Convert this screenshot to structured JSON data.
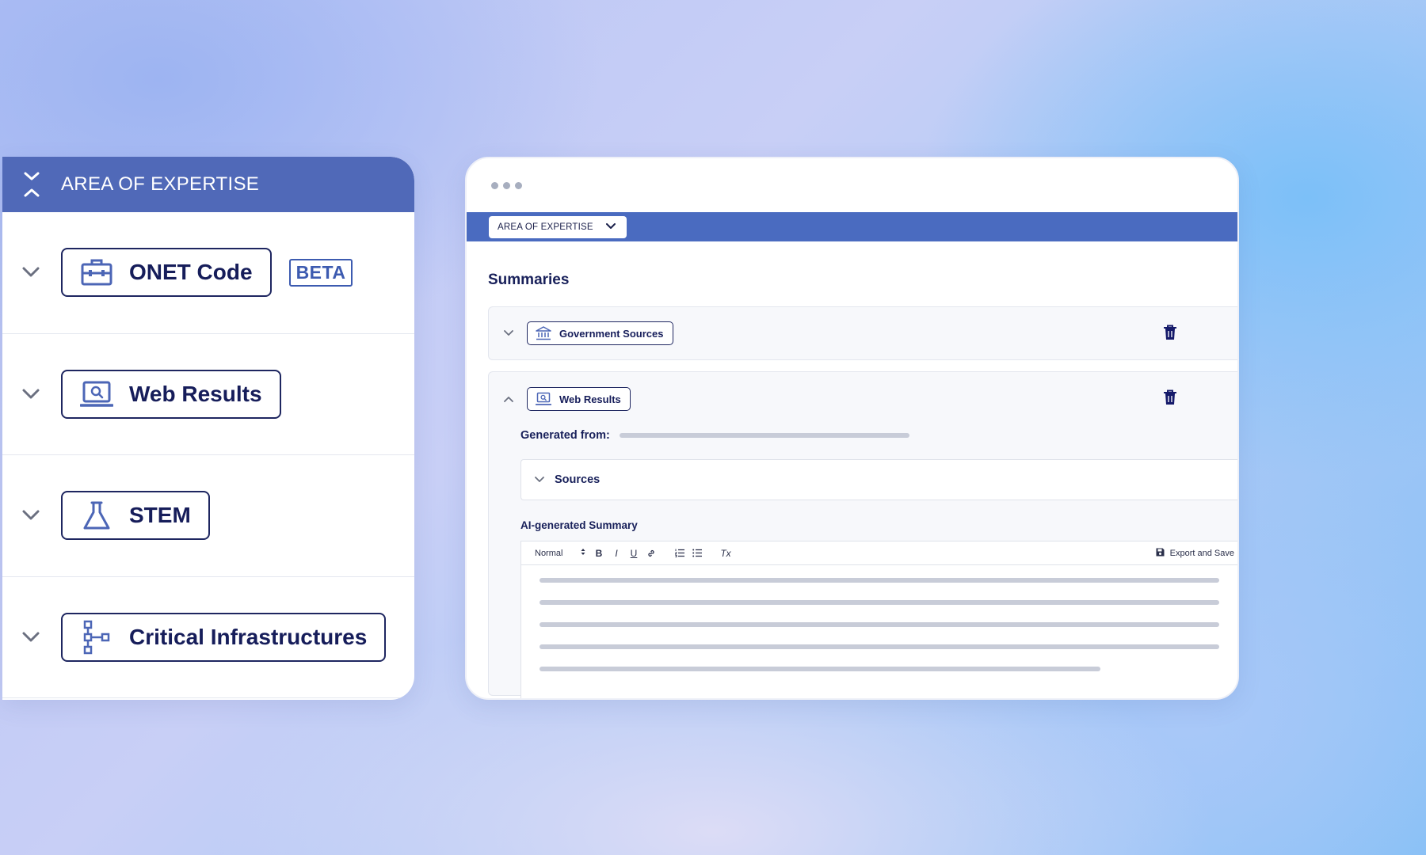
{
  "left_panel": {
    "title": "AREA OF EXPERTISE",
    "items": [
      {
        "label": "ONET Code",
        "icon": "briefcase-icon",
        "badge": "BETA"
      },
      {
        "label": "Web Results",
        "icon": "laptop-search-icon"
      },
      {
        "label": "STEM",
        "icon": "flask-icon"
      },
      {
        "label": "Critical Infrastructures",
        "icon": "hierarchy-icon"
      }
    ]
  },
  "window": {
    "select_label": "AREA OF EXPERTISE",
    "summaries_title": "Summaries",
    "cards": [
      {
        "label": "Government Sources",
        "icon": "bank-icon",
        "expanded": false
      },
      {
        "label": "Web Results",
        "icon": "laptop-search-icon",
        "expanded": true
      }
    ],
    "generated_from_label": "Generated from:",
    "sources_label": "Sources",
    "ai_summary_label": "AI-generated Summary",
    "toolbar": {
      "format_select": "Normal",
      "bold": "B",
      "italic": "I",
      "underline": "U",
      "clear_format": "Tx",
      "export_label": "Export and Save"
    }
  },
  "colors": {
    "header_blue": "#5069b8",
    "bar_blue": "#4a6bc0",
    "text_navy": "#161d5a",
    "accent_blue": "#3d5bb0"
  }
}
